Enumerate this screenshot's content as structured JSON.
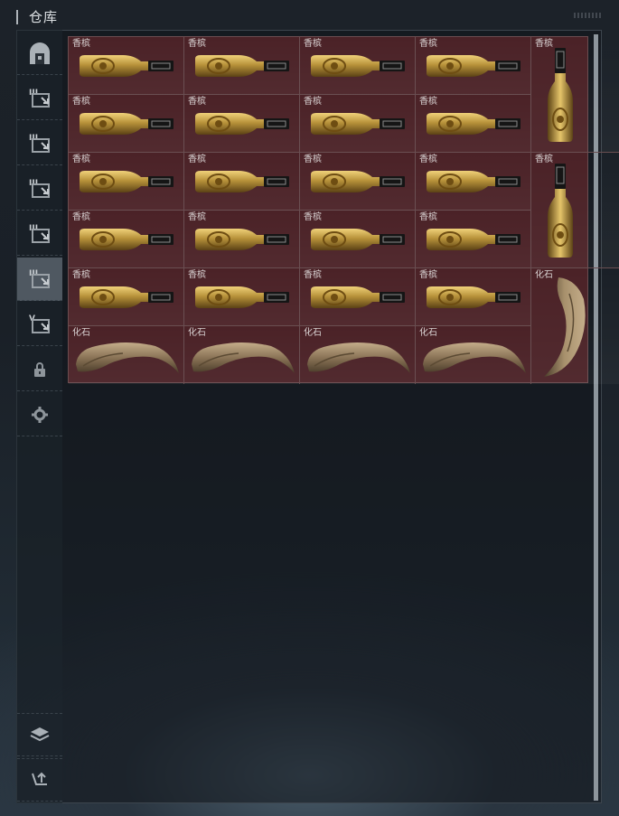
{
  "header": {
    "title": "仓库"
  },
  "sidebar": {
    "items": [
      {
        "name": "sidebar-item-overview",
        "icon": "vault-door-icon"
      },
      {
        "name": "sidebar-item-tab-1",
        "icon": "tab-1-icon",
        "numeral": "III"
      },
      {
        "name": "sidebar-item-tab-2",
        "icon": "tab-2-icon",
        "numeral": "III"
      },
      {
        "name": "sidebar-item-tab-3",
        "icon": "tab-3-icon",
        "numeral": "III"
      },
      {
        "name": "sidebar-item-tab-4",
        "icon": "tab-4-icon",
        "numeral": "III"
      },
      {
        "name": "sidebar-item-tab-5",
        "icon": "tab-5-icon",
        "numeral": "III",
        "active": true
      },
      {
        "name": "sidebar-item-tab-6",
        "icon": "tab-6-icon",
        "numeral": "V"
      },
      {
        "name": "sidebar-item-lock",
        "icon": "lock-icon"
      },
      {
        "name": "sidebar-item-settings",
        "icon": "gear-icon"
      }
    ],
    "bottom": [
      {
        "name": "layers-button",
        "icon": "layers-icon"
      },
      {
        "name": "transfer-button",
        "icon": "transfer-icon"
      }
    ]
  },
  "inventory": {
    "items": [
      {
        "label": "香槟",
        "kind": "bottle-h"
      },
      {
        "label": "香槟",
        "kind": "bottle-h"
      },
      {
        "label": "香槟",
        "kind": "bottle-h"
      },
      {
        "label": "香槟",
        "kind": "bottle-h"
      },
      {
        "label": "香槟",
        "kind": "bottle-v"
      },
      {
        "label": "香槟",
        "kind": "bottle-h"
      },
      {
        "label": "香槟",
        "kind": "bottle-h"
      },
      {
        "label": "香槟",
        "kind": "bottle-h"
      },
      {
        "label": "香槟",
        "kind": "bottle-h"
      },
      {
        "label": "香槟",
        "kind": "bottle-h"
      },
      {
        "label": "香槟",
        "kind": "bottle-h"
      },
      {
        "label": "香槟",
        "kind": "bottle-h"
      },
      {
        "label": "香槟",
        "kind": "bottle-h"
      },
      {
        "label": "香槟",
        "kind": "bottle-v"
      },
      {
        "label": "香槟",
        "kind": "bottle-h"
      },
      {
        "label": "香槟",
        "kind": "bottle-h"
      },
      {
        "label": "香槟",
        "kind": "bottle-h"
      },
      {
        "label": "香槟",
        "kind": "bottle-h"
      },
      {
        "label": "香槟",
        "kind": "bottle-h"
      },
      {
        "label": "香槟",
        "kind": "bottle-h"
      },
      {
        "label": "香槟",
        "kind": "bottle-h"
      },
      {
        "label": "香槟",
        "kind": "bottle-h"
      },
      {
        "label": "化石",
        "kind": "claw-v"
      },
      {
        "label": "化石",
        "kind": "claw-h"
      },
      {
        "label": "化石",
        "kind": "claw-h"
      },
      {
        "label": "化石",
        "kind": "claw-h"
      },
      {
        "label": "化石",
        "kind": "claw-h"
      }
    ]
  },
  "colors": {
    "grid_bg": "#4b2227",
    "bottle_gold": "#b8923a",
    "fossil": "#8a7356",
    "active_tab": "#4f5861"
  }
}
